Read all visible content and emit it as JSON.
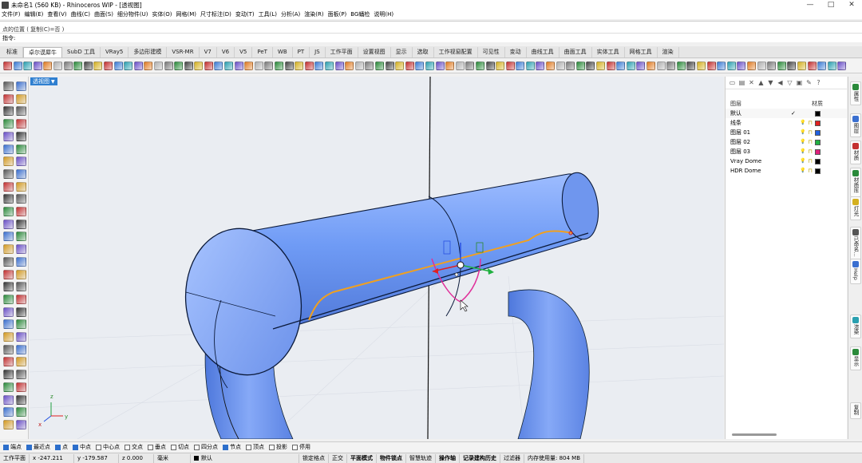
{
  "window": {
    "title": "未命名1 (560 KB) - Rhinoceros WIP - [透视图]",
    "buttons": [
      "—",
      "□",
      "✕"
    ]
  },
  "menu": [
    "文件(F)",
    "编辑(E)",
    "查看(V)",
    "曲线(C)",
    "曲面(S)",
    "细分物件(U)",
    "实体(O)",
    "网格(M)",
    "尺寸标注(D)",
    "变动(T)",
    "工具(L)",
    "分析(A)",
    "渲染(R)",
    "面板(P)",
    "BG蛹检",
    "说明(H)"
  ],
  "command": {
    "history": "点的位置 ( 复制(C)=否 )",
    "prompt": "指令:",
    "value": ""
  },
  "tabs": [
    "标准",
    "卓尔谟犀牛",
    "SubD 工具",
    "VRay5",
    "多边形建模",
    "VSR-MR",
    "V7",
    "V6",
    "V5",
    "PeT",
    "WB",
    "PT",
    "JS",
    "工作平面",
    "设置视图",
    "显示",
    "选取",
    "工作视窗配置",
    "可见性",
    "变动",
    "曲线工具",
    "曲面工具",
    "实体工具",
    "网格工具",
    "渲染"
  ],
  "active_tab": "卓尔谟犀牛",
  "viewport": {
    "label": "透视图",
    "axes": {
      "x": "x",
      "y": "y",
      "z": "z"
    }
  },
  "layers": {
    "header_name": "图层",
    "header_material": "材质",
    "rows": [
      {
        "name": "默认",
        "current": "✓",
        "color": "#000000"
      },
      {
        "name": "线条",
        "current": "",
        "color": "#e02020"
      },
      {
        "name": "图层 01",
        "current": "",
        "color": "#2060e0"
      },
      {
        "name": "图层 02",
        "current": "",
        "color": "#20b040"
      },
      {
        "name": "图层 03",
        "current": "",
        "color": "#e0207a"
      },
      {
        "name": "Vray Dome",
        "current": "",
        "color": "#000000"
      },
      {
        "name": "HDR Dome",
        "current": "",
        "color": "#000000"
      }
    ]
  },
  "side_tabs": [
    "属性",
    "图层",
    "材质",
    "材质库",
    "灯光",
    "已命名...",
    "Help",
    "渲染",
    "显示"
  ],
  "side_tabs_extra": "复制",
  "osnaps": [
    {
      "label": "端点",
      "on": true
    },
    {
      "label": "最近点",
      "on": true
    },
    {
      "label": "点",
      "on": true
    },
    {
      "label": "中点",
      "on": true
    },
    {
      "label": "中心点",
      "on": false
    },
    {
      "label": "交点",
      "on": false
    },
    {
      "label": "垂点",
      "on": false
    },
    {
      "label": "切点",
      "on": false
    },
    {
      "label": "四分点",
      "on": false
    },
    {
      "label": "节点",
      "on": true
    },
    {
      "label": "顶点",
      "on": false
    },
    {
      "label": "投影",
      "on": false
    },
    {
      "label": "停用",
      "on": false
    }
  ],
  "status": {
    "cplane": "工作平面",
    "x": "x -247.211",
    "y": "y -179.587",
    "z": "z 0.000",
    "unit": "毫米",
    "layer": "默认",
    "toggles": [
      "锁定格点",
      "正交",
      "平面模式",
      "物件锁点",
      "智慧轨迹",
      "操作轴",
      "记录建构历史",
      "过滤器"
    ],
    "bold_toggles": [
      "平面模式",
      "物件锁点",
      "操作轴",
      "记录建构历史"
    ],
    "memory": "内存使用量: 804 MB"
  },
  "colors": {
    "model_blue": "#5f8ff0",
    "curve_orange": "#f0a020",
    "selection_pink": "#e0309a",
    "viewport_bg": "#eaedf2",
    "label_blue": "#2f7fd0"
  }
}
